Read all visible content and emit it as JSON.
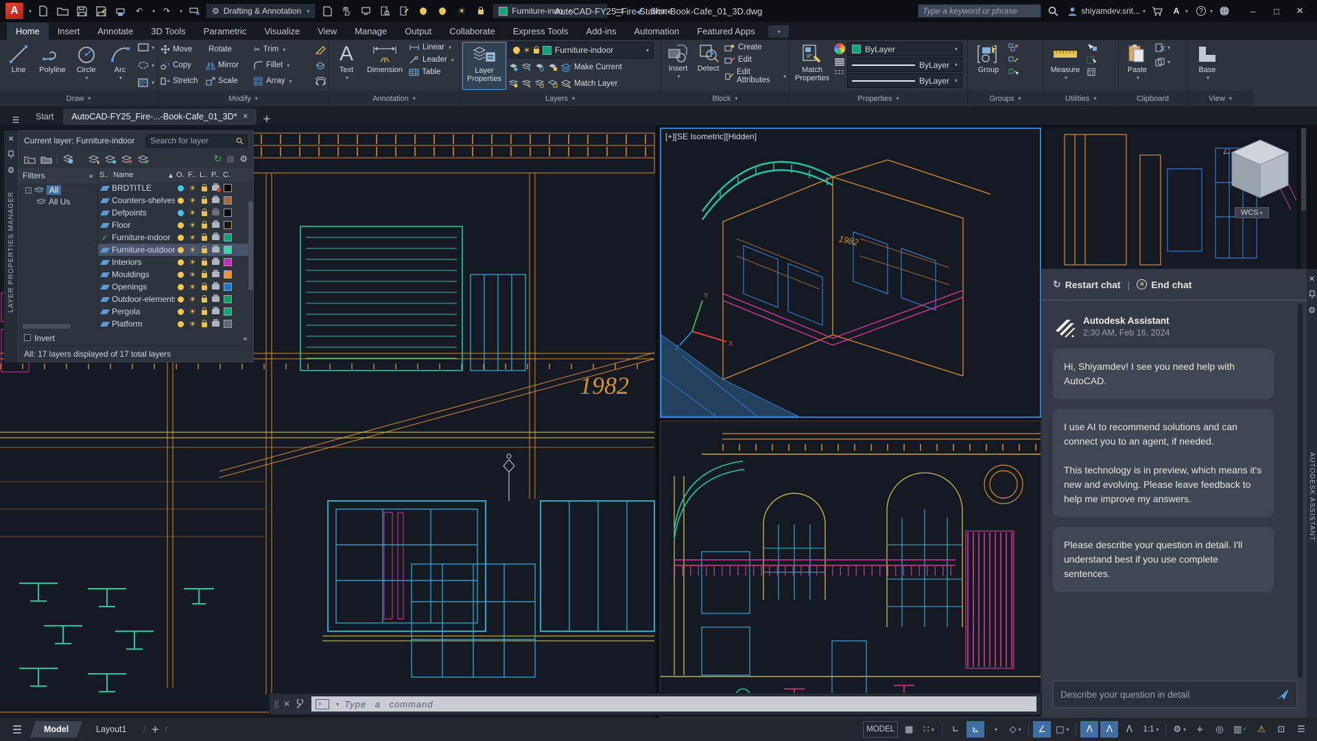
{
  "icons": {
    "dropdown": "▾",
    "hamburger": "☰",
    "close": "✕",
    "minimize": "–",
    "maximize": "□",
    "undo": "↶",
    "redo": "↷",
    "sun": "☀",
    "gear": "⚙",
    "scissors": "✂",
    "check": "✓",
    "refresh": "↻",
    "star": "*",
    "snow": "*",
    "xred": "✕",
    "chevrons": "«",
    "sort": "▲",
    "ellipsis": "⋯",
    "plus": "+",
    "slash": "/",
    "question": "?",
    "grid": "▦",
    "snap": "∷",
    "ortho": "∟",
    "polar": "⊾",
    "iso": "◇",
    "angle": "∠",
    "osnap": "□",
    "person": "Λ",
    "isolate": "◎",
    "perf": "▥",
    "warn": "⚠",
    "fullscreen": "⊡",
    "text_a": "A",
    "pipe": "|"
  },
  "titlebar": {
    "logo": "A",
    "workspace": "Drafting & Annotation",
    "layer_combo": "Furniture-indo",
    "share": "Share",
    "filename": "AutoCAD-FY25_Fire-Station-Book-Cafe_01_3D.dwg",
    "search_placeholder": "Type a keyword or phrase",
    "user": "shiyamdev.srit..."
  },
  "ribbon_tabs": [
    {
      "label": "Home",
      "cls": "active"
    },
    {
      "label": "Insert",
      "cls": ""
    },
    {
      "label": "Annotate",
      "cls": ""
    },
    {
      "label": "3D Tools",
      "cls": ""
    },
    {
      "label": "Parametric",
      "cls": ""
    },
    {
      "label": "Visualize",
      "cls": ""
    },
    {
      "label": "View",
      "cls": ""
    },
    {
      "label": "Manage",
      "cls": ""
    },
    {
      "label": "Output",
      "cls": ""
    },
    {
      "label": "Collaborate",
      "cls": ""
    },
    {
      "label": "Express Tools",
      "cls": ""
    },
    {
      "label": "Add-ins",
      "cls": ""
    },
    {
      "label": "Automation",
      "cls": ""
    },
    {
      "label": "Featured Apps",
      "cls": ""
    }
  ],
  "panels": {
    "draw": {
      "label": "Draw",
      "line": "Line",
      "polyline": "Polyline",
      "circle": "Circle",
      "arc": "Arc"
    },
    "modify": {
      "label": "Modify",
      "move": "Move",
      "rotate": "Rotate",
      "trim": "Trim",
      "copy": "Copy",
      "mirror": "Mirror",
      "fillet": "Fillet",
      "stretch": "Stretch",
      "scale": "Scale",
      "array": "Array"
    },
    "annotation": {
      "label": "Annotation",
      "text": "Text",
      "dimension": "Dimension",
      "linear": "Linear",
      "leader": "Leader",
      "table": "Table"
    },
    "layers": {
      "label": "Layers",
      "big": "Layer Properties",
      "combo": "Furniture-indoor",
      "make_current": "Make Current",
      "match_layer": "Match Layer"
    },
    "block": {
      "label": "Block",
      "insert": "Insert",
      "detect": "Detect",
      "create": "Create",
      "edit": "Edit",
      "edit_attrs": "Edit Attributes"
    },
    "properties": {
      "label": "Properties",
      "big": "Match Properties",
      "combo1": "ByLayer",
      "combo2": "ByLayer",
      "combo3": "ByLayer"
    },
    "groups": {
      "label": "Groups",
      "big": "Group"
    },
    "utilities": {
      "label": "Utilities",
      "big": "Measure"
    },
    "clipboard": {
      "label": "Clipboard",
      "big": "Paste"
    },
    "view": {
      "label": "View",
      "big": "Base"
    }
  },
  "doc_tabs": {
    "start": "Start",
    "active": "AutoCAD-FY25_Fire-...-Book-Cafe_01_3D*"
  },
  "layer_palette": {
    "current": "Current layer: Furniture-indoor",
    "search_placeholder": "Search for layer",
    "filters_label": "Filters",
    "tree_all": "All",
    "tree_all_used": "All Us",
    "columns": {
      "s": "S..",
      "name": "Name",
      "o": "O.",
      "f": "F..",
      "l": "L..",
      "p": "P..",
      "c": "C."
    },
    "layers": [
      {
        "name": "BRDTITLE",
        "swatch": "#0a0a0a",
        "bulb": "#45c8e8",
        "state": "",
        "plotcls": "pno"
      },
      {
        "name": "Counters-shelves",
        "swatch": "#a06a3f",
        "bulb": "#f2c94c",
        "state": "",
        "plotcls": ""
      },
      {
        "name": "Defpoints",
        "swatch": "#0a0a0a",
        "bulb": "#45c8e8",
        "state": "",
        "plotcls": "pgrey"
      },
      {
        "name": "Floor",
        "swatch": "#241509",
        "bulb": "#f2c94c",
        "state": "",
        "plotcls": ""
      },
      {
        "name": "Furniture-indoor",
        "swatch": "#06a877",
        "bulb": "#f2c94c",
        "state": "current",
        "plotcls": ""
      },
      {
        "name": "Furniture-outdoor",
        "swatch": "#35d7b0",
        "bulb": "#f2c94c",
        "state": "selected",
        "plotcls": ""
      },
      {
        "name": "Interiors",
        "swatch": "#c02bc0",
        "bulb": "#f2c94c",
        "state": "",
        "plotcls": ""
      },
      {
        "name": "Mouldings",
        "swatch": "#f09331",
        "bulb": "#f2c94c",
        "state": "",
        "plotcls": ""
      },
      {
        "name": "Openings",
        "swatch": "#1e78d0",
        "bulb": "#f2c94c",
        "state": "",
        "plotcls": ""
      },
      {
        "name": "Outdoor-elements",
        "swatch": "#0da05f",
        "bulb": "#f2c94c",
        "state": "",
        "plotcls": ""
      },
      {
        "name": "Pergola",
        "swatch": "#0fa874",
        "bulb": "#f2c94c",
        "state": "",
        "plotcls": ""
      },
      {
        "name": "Platform",
        "swatch": "#606770",
        "bulb": "#f2c94c",
        "state": "",
        "plotcls": ""
      }
    ],
    "invert_label": "Invert",
    "status": "All: 17 layers displayed of 17 total layers",
    "title_vertical": "LAYER PROPERTIES MANAGER"
  },
  "drawing": {
    "viewport_label": "[+][SE Isometric][Hidden]",
    "wcs": "WCS",
    "year": "1982",
    "axis_x": "X",
    "axis_y": "Y",
    "axis_z": "Z"
  },
  "assistant": {
    "restart": "Restart chat",
    "end": "End chat",
    "name": "Autodesk Assistant",
    "time": "2:30 AM, Feb 16, 2024",
    "messages": [
      {
        "text": "Hi, Shiyamdev! I see you need help with AutoCAD."
      },
      {
        "text": "I use AI to recommend solutions and can connect you to an agent, if needed.\n\nThis technology is in preview, which means it's new and evolving. Please leave feedback to help me improve my answers."
      },
      {
        "text": "Please describe your question in detail. I'll understand best if you use complete sentences."
      }
    ],
    "input_placeholder": "Describe your question in detail",
    "title_vertical": "AUTODESK ASSISTANT"
  },
  "command": {
    "placeholder": "Type a command",
    "prompt": ">"
  },
  "statusbar": {
    "model_tab": "Model",
    "layout_tab": "Layout1",
    "add": "+",
    "model_btn": "MODEL",
    "scale": "1:1"
  }
}
